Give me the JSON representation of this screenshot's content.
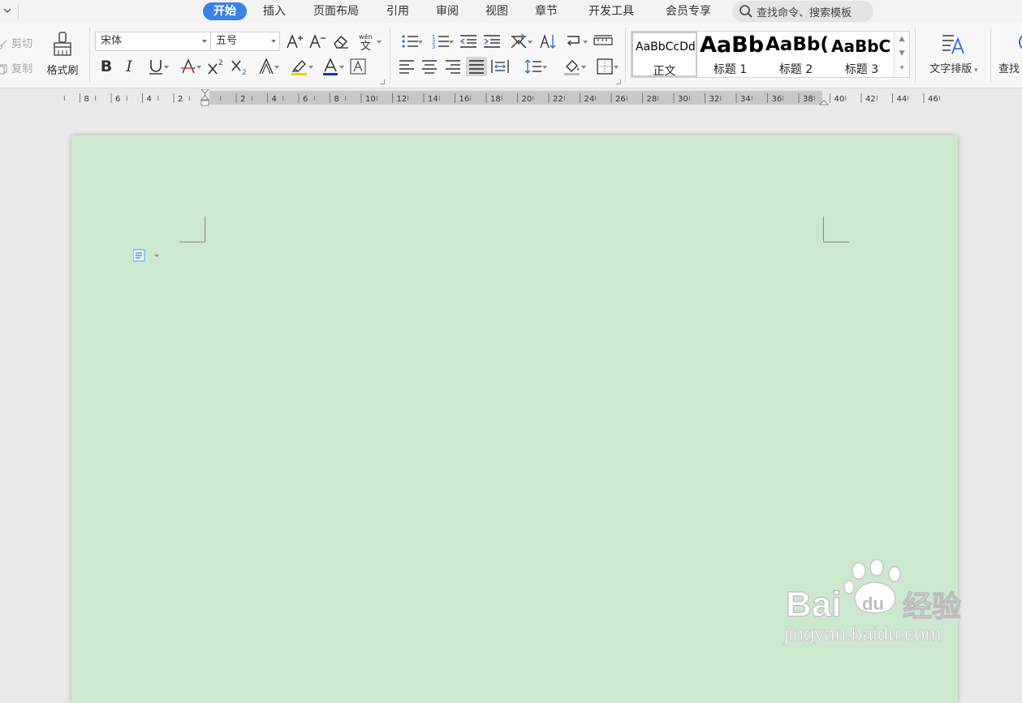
{
  "menu": {
    "tabs": [
      "开始",
      "插入",
      "页面布局",
      "引用",
      "审阅",
      "视图",
      "章节",
      "开发工具",
      "会员专享"
    ],
    "active_tab": "开始",
    "search_placeholder": "查找命令、搜索模板"
  },
  "ribbon": {
    "clipboard": {
      "cut": "剪切",
      "copy": "复制",
      "format_painter": "格式刷"
    },
    "font": {
      "name": "宋体",
      "size": "五号"
    },
    "styles": [
      {
        "preview": "AaBbCcDd",
        "name": "正文"
      },
      {
        "preview": "AaBb",
        "name": "标题 1"
      },
      {
        "preview": "AaBb(",
        "name": "标题 2"
      },
      {
        "preview": "AaBbC",
        "name": "标题 3"
      }
    ],
    "text_layout": "文字排版",
    "find": "查找"
  },
  "ruler": {
    "labels": [
      "8",
      "6",
      "4",
      "2",
      "2",
      "4",
      "6",
      "8",
      "10",
      "12",
      "14",
      "16",
      "18",
      "20",
      "22",
      "24",
      "26",
      "28",
      "30",
      "32",
      "34",
      "36",
      "38",
      "40",
      "42",
      "44",
      "46"
    ]
  },
  "watermark": {
    "brand": "Bai",
    "brand_suffix": "du",
    "brand_cn": "经验",
    "url": "jingyan.baidu.com"
  },
  "colors": {
    "active_tab": "#3b82e8",
    "page_background": "#cce8cf",
    "font_color_underline": "#1a2ccf",
    "highlight": "#f2d200"
  }
}
